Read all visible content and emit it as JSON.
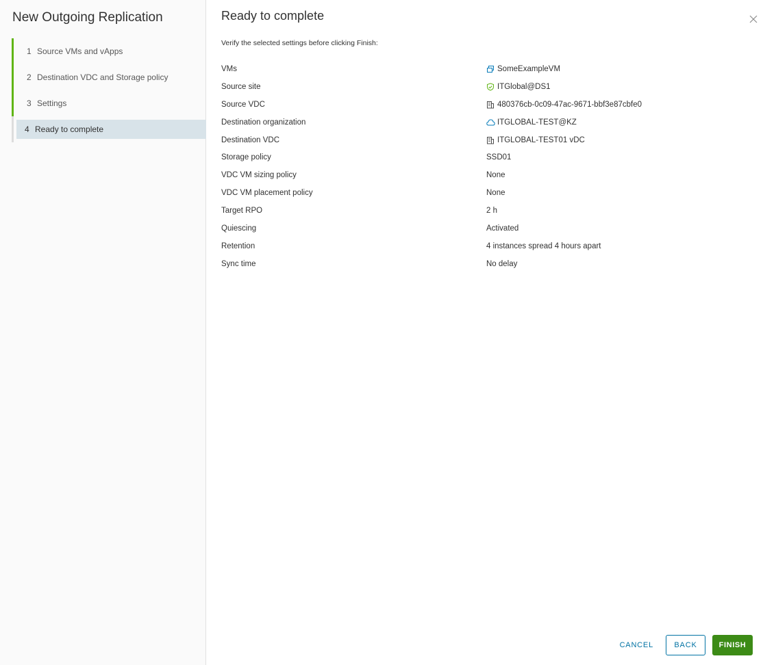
{
  "wizard": {
    "title": "New Outgoing Replication",
    "steps": [
      {
        "num": "1",
        "label": "Source VMs and vApps"
      },
      {
        "num": "2",
        "label": "Destination VDC and Storage policy"
      },
      {
        "num": "3",
        "label": "Settings"
      },
      {
        "num": "4",
        "label": "Ready to complete"
      }
    ]
  },
  "page": {
    "title": "Ready to complete",
    "subtitle": "Verify the selected settings before clicking Finish:"
  },
  "summary": [
    {
      "label": "VMs",
      "value": "SomeExampleVM",
      "icon": "vm-icon"
    },
    {
      "label": "Source site",
      "value": "ITGlobal@DS1",
      "icon": "site-shield-icon"
    },
    {
      "label": "Source VDC",
      "value": "480376cb-0c09-47ac-9671-bbf3e87cbfe0",
      "icon": "vdc-building-icon"
    },
    {
      "label": "Destination organization",
      "value": "ITGLOBAL-TEST@KZ",
      "icon": "cloud-icon"
    },
    {
      "label": "Destination VDC",
      "value": "ITGLOBAL-TEST01 vDC",
      "icon": "vdc-building-icon"
    },
    {
      "label": "Storage policy",
      "value": "SSD01"
    },
    {
      "label": "VDC VM sizing policy",
      "value": "None"
    },
    {
      "label": "VDC VM placement policy",
      "value": "None"
    },
    {
      "label": "Target RPO",
      "value": "2 h"
    },
    {
      "label": "Quiescing",
      "value": "Activated"
    },
    {
      "label": "Retention",
      "value": "4 instances spread 4 hours apart"
    },
    {
      "label": "Sync time",
      "value": "No delay"
    }
  ],
  "buttons": {
    "cancel": "CANCEL",
    "back": "BACK",
    "finish": "FINISH"
  },
  "colors": {
    "step_done": "#60b515",
    "step_current_bg": "#d8e3e9",
    "primary": "#3c8b16",
    "link": "#0072a3"
  }
}
